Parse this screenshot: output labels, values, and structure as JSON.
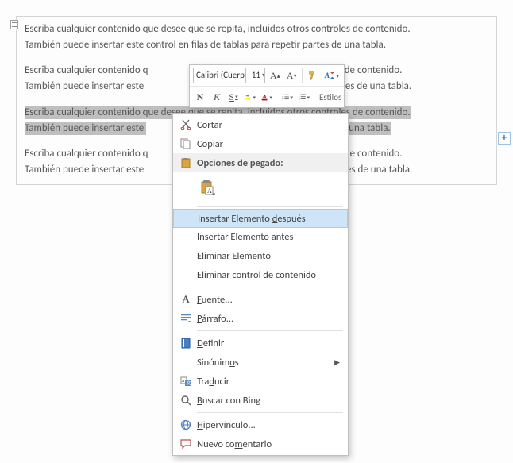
{
  "doc": {
    "paragraph": "Escriba cualquier contenido que desee que se repita, incluidos otros controles de contenido. También puede insertar este control en filas de tablas para repetir partes de una tabla.",
    "para_line1": "Escriba cualquier contenido que desee que se repita, incluidos otros controles de contenido.",
    "para_line2": "También puede insertar este control en filas de tablas para repetir partes de una tabla.",
    "para_cut_l1_a": "Escriba cualquier contenido q",
    "para_cut_l1_b": "troles de contenido.",
    "para_cut_l2_a": "También puede insertar este",
    "para_cut_l2_b": "es de una tabla.",
    "para_sel_l1_a": "Escriba cualquier contenido que desee que se repita, incluidos otros controles de contenido.",
    "para_sel_l2_a": "También puede insertar este ",
    "para_sel_l2_b": "r partes de una tabla.",
    "para_last_l1_a": "Escriba cualquier contenido q",
    "para_last_l1_b": "os controles de contenido.",
    "para_last_l2_a": "También puede insertar este",
    "para_last_l2_b": "r partes de una tabla."
  },
  "mini": {
    "font_name": "Calibri (Cuerpo",
    "font_size": "11",
    "styles_label": "Estilos",
    "bold": "N",
    "italic": "K",
    "underline": "S"
  },
  "menu": {
    "cut": "Cortar",
    "copy": "Copiar",
    "paste_header": "Opciones de pegado:",
    "insert_after_pre": "Insertar Elemento ",
    "insert_after_u": "d",
    "insert_after_post": "espués",
    "insert_before_pre": "Insertar Elemento ",
    "insert_before_u": "a",
    "insert_before_post": "ntes",
    "remove_u": "E",
    "remove_post": "liminar Elemento",
    "remove_cc": "Eliminar control de contenido",
    "font_u": "F",
    "font_post": "uente...",
    "para_u": "P",
    "para_post": "árrafo...",
    "define_u": "D",
    "define_post": "efinir",
    "syn_pre": "Sinónim",
    "syn_u": "o",
    "syn_post": "s",
    "translate_pre": "Tra",
    "translate_u": "d",
    "translate_post": "ucir",
    "bing_u": "B",
    "bing_post": "uscar con Bing",
    "hyper_u": "H",
    "hyper_post": "ipervínculo...",
    "comment_pre": "Nuevo co",
    "comment_u": "m",
    "comment_post": "entario"
  }
}
